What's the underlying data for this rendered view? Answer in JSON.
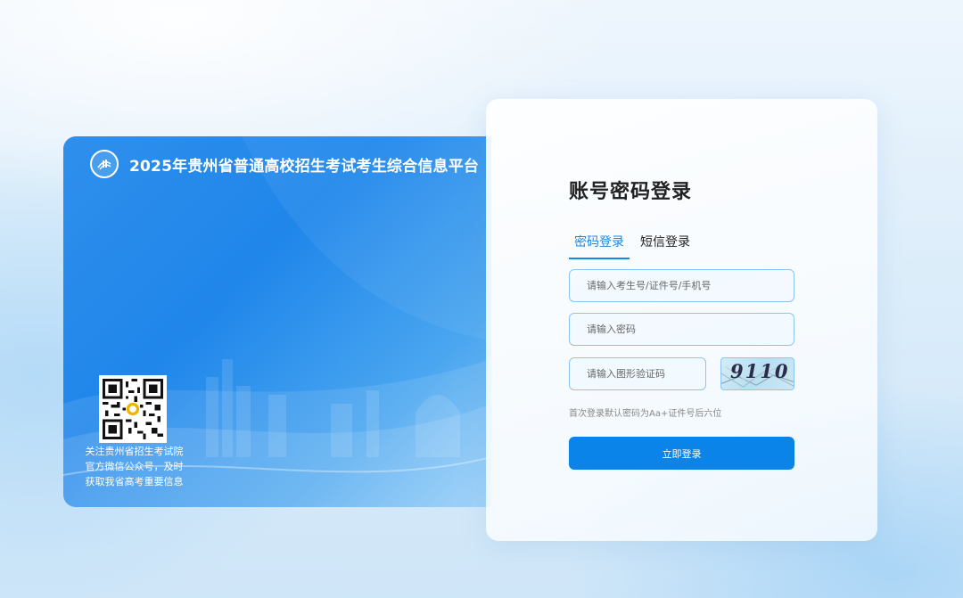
{
  "banner": {
    "title": "2025年贵州省普通高校招生考试考生综合信息平台",
    "logo_icon": "exam-logo-icon",
    "qr_icon": "qr-code-icon",
    "qr_caption": [
      "关注贵州省招生考试院",
      "官方微信公众号，及时",
      "获取我省高考重要信息"
    ]
  },
  "login": {
    "heading": "账号密码登录",
    "tabs": [
      {
        "label": "密码登录",
        "active": true
      },
      {
        "label": "短信登录",
        "active": false
      }
    ],
    "account_placeholder": "请输入考生号/证件号/手机号",
    "password_placeholder": "请输入密码",
    "captcha_placeholder": "请输入图形验证码",
    "captcha_text": "9110",
    "hint": "首次登录默认密码为Aa+证件号后六位",
    "submit_label": "立即登录"
  },
  "colors": {
    "accent": "#1a87e6",
    "button": "#0b84ea",
    "banner": "#1f86ea"
  }
}
